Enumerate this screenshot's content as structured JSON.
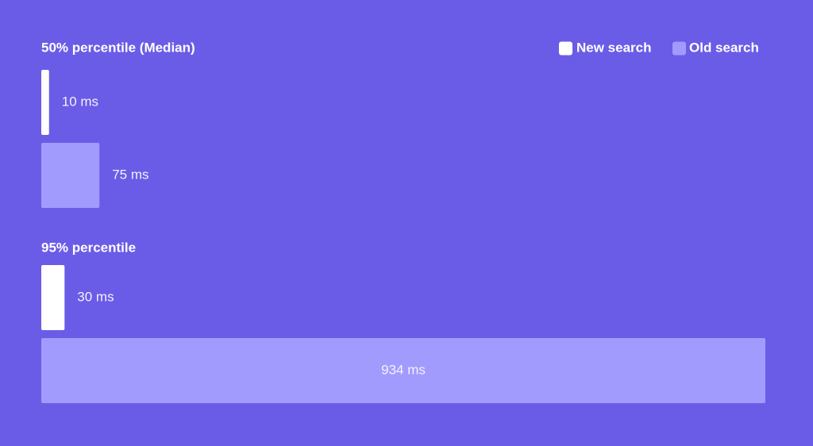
{
  "colors": {
    "background": "#6b5ce7",
    "new_search": "#ffffff",
    "old_search": "#a29bfe",
    "label_on_background": "#f3f1ff",
    "label_inside_bar": "#f3f1ff"
  },
  "legend": {
    "position": "top-right",
    "items": [
      {
        "label": "New search",
        "series": "new"
      },
      {
        "label": "Old search",
        "series": "old"
      }
    ]
  },
  "chart_data": {
    "type": "bar",
    "orientation": "horizontal",
    "unit": "ms",
    "grid": false,
    "xlim": [
      0,
      934
    ],
    "groups": [
      {
        "title": "50% percentile (Median)",
        "bars": [
          {
            "series": "New search",
            "value": 10,
            "label": "10 ms"
          },
          {
            "series": "Old search",
            "value": 75,
            "label": "75 ms"
          }
        ]
      },
      {
        "title": "95% percentile",
        "bars": [
          {
            "series": "New search",
            "value": 30,
            "label": "30 ms"
          },
          {
            "series": "Old search",
            "value": 934,
            "label": "934 ms"
          }
        ]
      }
    ]
  }
}
